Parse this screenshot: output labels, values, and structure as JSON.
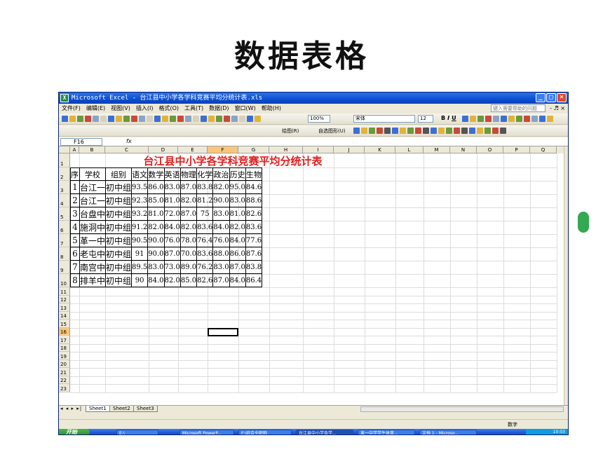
{
  "slide": {
    "title": "数据表格"
  },
  "window": {
    "title": "Microsoft Excel - 台江县中小学各学科竞赛平均分统计表.xls",
    "app_icon": "excel-icon",
    "buttons": {
      "min": "_",
      "max": "□",
      "close": "×"
    }
  },
  "menu": {
    "items": [
      "文件(F)",
      "编辑(E)",
      "视图(V)",
      "插入(I)",
      "格式(O)",
      "工具(T)",
      "数据(D)",
      "窗口(W)",
      "帮助(H)"
    ],
    "help_placeholder": "键入需要帮助的问题",
    "mdi_controls": "- ♬ ×"
  },
  "toolbar": {
    "zoom": "100%",
    "font_name": "宋体",
    "font_size": "12",
    "bold": "B",
    "italic": "I",
    "underline": "U",
    "draw_label": "绘图(R)",
    "autoshapes_label": "自选图形(U)"
  },
  "formula_bar": {
    "name_box": "F16",
    "fx": "fx"
  },
  "sheet": {
    "columns": [
      "A",
      "B",
      "C",
      "D",
      "E",
      "F",
      "G",
      "H",
      "I",
      "J",
      "K",
      "L",
      "M",
      "N",
      "O",
      "P",
      "Q"
    ],
    "rows": [
      "1",
      "2",
      "3",
      "4",
      "5",
      "6",
      "7",
      "8",
      "9",
      "10",
      "11",
      "12",
      "13",
      "14",
      "15",
      "16",
      "17",
      "18",
      "19",
      "20",
      "21",
      "22",
      "23"
    ],
    "selected_column": "F",
    "selected_row": "16",
    "table_title": "台江县中小学各学科竞赛平均分统计表",
    "headers": [
      "序号",
      "学校",
      "组别",
      "语文",
      "数学",
      "英语",
      "物理",
      "化学",
      "政治",
      "历史",
      "生物"
    ],
    "data_rows": [
      [
        "1",
        "台江一中",
        "初中组",
        "93.5",
        "86.0",
        "83.0",
        "87.0",
        "83.8",
        "82.0",
        "95.0",
        "84.6"
      ],
      [
        "2",
        "台江一中",
        "初中组",
        "92.3",
        "85.0",
        "81.0",
        "82.0",
        "81.2",
        "90.0",
        "83.0",
        "88.6"
      ],
      [
        "3",
        "台盘中学",
        "初中组",
        "93.2",
        "81.0",
        "72.0",
        "87.0",
        "75",
        "83.0",
        "81.0",
        "82.6"
      ],
      [
        "4",
        "施洞中学",
        "初中组",
        "91.2",
        "82.0",
        "84.0",
        "82.0",
        "83.6",
        "84.0",
        "82.0",
        "83.6"
      ],
      [
        "5",
        "革一中学",
        "初中组",
        "90.5",
        "90.0",
        "76.0",
        "78.0",
        "76.4",
        "76.0",
        "84.0",
        "77.6"
      ],
      [
        "6",
        "老屯中学",
        "初中组",
        "91",
        "90.0",
        "87.0",
        "70.0",
        "83.6",
        "88.0",
        "86.0",
        "87.6"
      ],
      [
        "7",
        "南宫中学",
        "初中组",
        "89.5",
        "83.0",
        "73.0",
        "89.0",
        "76.2",
        "83.0",
        "87.0",
        "83.8"
      ],
      [
        "8",
        "排羊中学",
        "初中组",
        "90",
        "84.0",
        "82.0",
        "85.0",
        "82.6",
        "87.0",
        "84.0",
        "86.4"
      ]
    ]
  },
  "sheet_tabs": [
    "Sheet1",
    "Sheet2",
    "Sheet3"
  ],
  "tab_nav": "◂ ◂ ▸ ▸|",
  "status": {
    "mode": "数字"
  },
  "taskbar": {
    "start": "开始",
    "tasks": [
      "E:\\",
      "Microsoft PowerP...",
      "F:\\综合全职称",
      "台江县中小学各学...",
      "革一中学学生体育...",
      "文档 1 - Microso..."
    ],
    "clock": "10:03"
  },
  "colors": {
    "title_red": "#E02020",
    "selection_orange": "#F9C77A",
    "xp_blue": "#0B4FD0"
  }
}
